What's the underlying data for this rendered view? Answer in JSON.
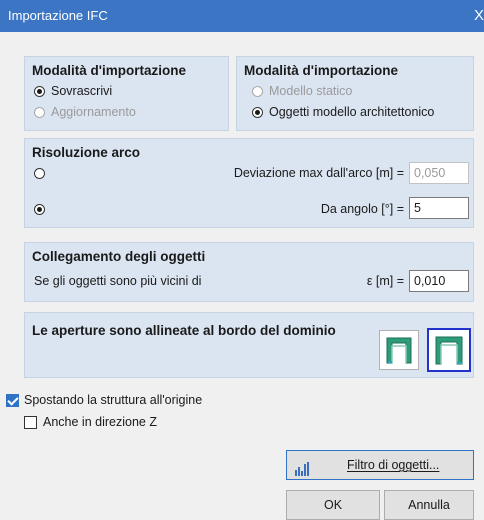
{
  "window": {
    "title": "Importazione IFC",
    "close_glyph": "X"
  },
  "import_mode": {
    "title": "Modalità d'importazione",
    "options": [
      {
        "label": "Sovrascrivi",
        "checked": true,
        "enabled": true
      },
      {
        "label": "Aggiornamento",
        "checked": false,
        "enabled": false
      }
    ]
  },
  "import_model": {
    "title": "Modalità d'importazione",
    "options": [
      {
        "label": "Modello statico",
        "checked": false,
        "enabled": false
      },
      {
        "label": "Oggetti modello architettonico",
        "checked": true,
        "enabled": true
      }
    ]
  },
  "arc_resolution": {
    "title": "Risoluzione arco",
    "max_deviation_label": "Deviazione max dall'arco [m] =",
    "max_deviation_value": "0,050",
    "angle_label": "Da angolo [°] =",
    "angle_value": "5"
  },
  "object_connection": {
    "title": "Collegamento degli oggetti",
    "description": "Se gli oggetti sono più vicini di",
    "epsilon_label": "ε [m] =",
    "epsilon_value": "0,010"
  },
  "openings": {
    "title": "Le aperture sono allineate al bordo del dominio",
    "selected_option": 2
  },
  "move_to_origin": {
    "label": "Spostando la struttura all'origine",
    "checked": true
  },
  "z_direction": {
    "label": "Anche in direzione Z",
    "checked": false
  },
  "buttons": {
    "filter": "Filtro di oggetti...",
    "ok": "OK",
    "cancel": "Annulla"
  },
  "colors": {
    "titlebar": "#3b75c3",
    "group_bg": "#dbe5f1",
    "accent": "#2f73c7",
    "icon_green": "#2e9c7a"
  }
}
